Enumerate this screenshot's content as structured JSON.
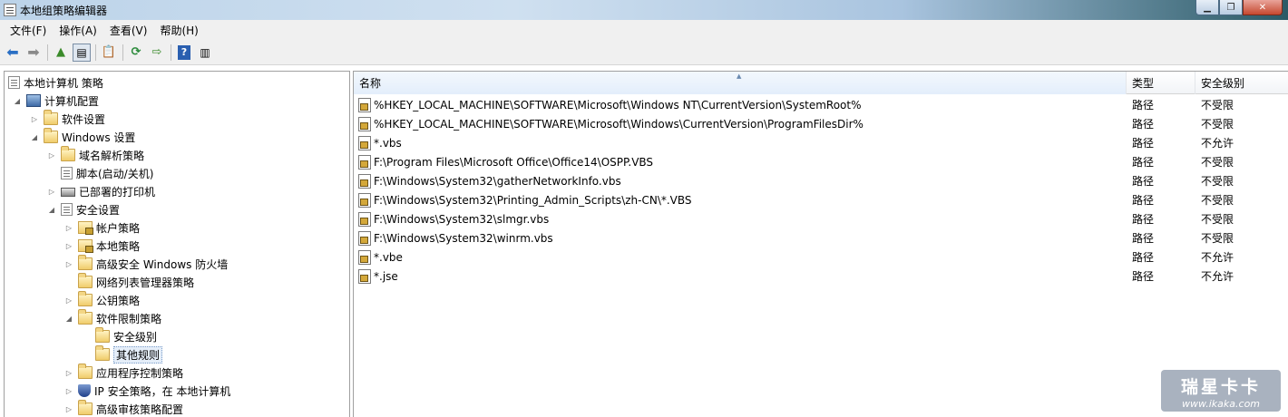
{
  "window": {
    "title": "本地组策略编辑器"
  },
  "menu": [
    "文件(F)",
    "操作(A)",
    "查看(V)",
    "帮助(H)"
  ],
  "toolbar_icons": [
    "back-arrow-icon",
    "forward-arrow-icon",
    "up-folder-icon",
    "show-hide-tree-icon",
    "properties-icon",
    "refresh-icon",
    "export-list-icon",
    "help-icon",
    "show-hide-action-pane-icon"
  ],
  "tree": [
    {
      "label": "本地计算机 策略",
      "icon": "policy-doc-icon",
      "expander": ""
    },
    {
      "label": "计算机配置",
      "icon": "computer-icon",
      "expander": "expanded"
    },
    {
      "label": "软件设置",
      "icon": "folder-icon",
      "expander": "collapsed"
    },
    {
      "label": "Windows 设置",
      "icon": "folder-icon",
      "expander": "expanded"
    },
    {
      "label": "域名解析策略",
      "icon": "folder-icon",
      "expander": "collapsed"
    },
    {
      "label": "脚本(启动/关机)",
      "icon": "script-doc-icon",
      "expander": ""
    },
    {
      "label": "已部署的打印机",
      "icon": "printer-icon",
      "expander": "collapsed"
    },
    {
      "label": "安全设置",
      "icon": "security-settings-icon",
      "expander": "expanded"
    },
    {
      "label": "帐户策略",
      "icon": "lock-folder-icon",
      "expander": "collapsed"
    },
    {
      "label": "本地策略",
      "icon": "lock-folder-icon",
      "expander": "collapsed"
    },
    {
      "label": "高级安全 Windows 防火墙",
      "icon": "folder-icon",
      "expander": "collapsed"
    },
    {
      "label": "网络列表管理器策略",
      "icon": "folder-icon",
      "expander": ""
    },
    {
      "label": "公钥策略",
      "icon": "folder-icon",
      "expander": "collapsed"
    },
    {
      "label": "软件限制策略",
      "icon": "folder-icon",
      "expander": "expanded"
    },
    {
      "label": "安全级别",
      "icon": "folder-icon",
      "expander": ""
    },
    {
      "label": "其他规则",
      "icon": "folder-icon",
      "expander": "",
      "selected": true
    },
    {
      "label": "应用程序控制策略",
      "icon": "folder-icon",
      "expander": "collapsed"
    },
    {
      "label": "IP 安全策略，在 本地计算机",
      "icon": "ip-security-shield-icon",
      "expander": "collapsed"
    },
    {
      "label": "高级审核策略配置",
      "icon": "folder-icon",
      "expander": "collapsed"
    }
  ],
  "list": {
    "columns": [
      "名称",
      "类型",
      "安全级别"
    ],
    "rows": [
      {
        "name": "%HKEY_LOCAL_MACHINE\\SOFTWARE\\Microsoft\\Windows NT\\CurrentVersion\\SystemRoot%",
        "type": "路径",
        "level": "不受限"
      },
      {
        "name": "%HKEY_LOCAL_MACHINE\\SOFTWARE\\Microsoft\\Windows\\CurrentVersion\\ProgramFilesDir%",
        "type": "路径",
        "level": "不受限"
      },
      {
        "name": "*.vbs",
        "type": "路径",
        "level": "不允许"
      },
      {
        "name": "F:\\Program Files\\Microsoft Office\\Office14\\OSPP.VBS",
        "type": "路径",
        "level": "不受限"
      },
      {
        "name": "F:\\Windows\\System32\\gatherNetworkInfo.vbs",
        "type": "路径",
        "level": "不受限"
      },
      {
        "name": "F:\\Windows\\System32\\Printing_Admin_Scripts\\zh-CN\\*.VBS",
        "type": "路径",
        "level": "不受限"
      },
      {
        "name": "F:\\Windows\\System32\\slmgr.vbs",
        "type": "路径",
        "level": "不受限"
      },
      {
        "name": "F:\\Windows\\System32\\winrm.vbs",
        "type": "路径",
        "level": "不受限"
      },
      {
        "name": "*.vbe",
        "type": "路径",
        "level": "不允许"
      },
      {
        "name": "*.jse",
        "type": "路径",
        "level": "不允许"
      }
    ]
  },
  "watermark": {
    "title": "瑞星卡卡",
    "url": "www.ikaka.com"
  }
}
